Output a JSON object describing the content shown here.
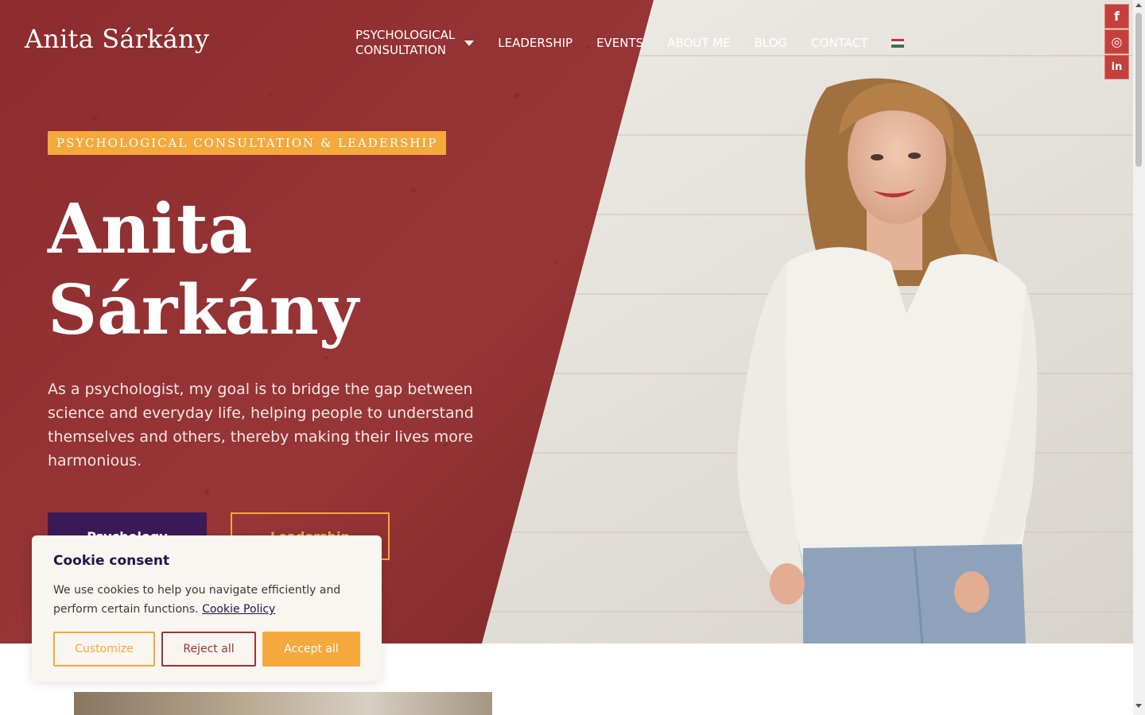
{
  "brand": {
    "logo_text": "Anita Sárkány"
  },
  "nav": {
    "items": [
      {
        "label_line1": "PSYCHOLOGICAL",
        "label_line2": "CONSULTATION",
        "has_dropdown": true
      },
      {
        "label": "LEADERSHIP"
      },
      {
        "label": "EVENTS"
      },
      {
        "label": "ABOUT ME"
      },
      {
        "label": "BLOG"
      },
      {
        "label": "CONTACT"
      }
    ],
    "language_flag": "hungary-flag-icon"
  },
  "social": [
    {
      "icon": "facebook-icon",
      "glyph": "f"
    },
    {
      "icon": "instagram-icon",
      "glyph": "◎"
    },
    {
      "icon": "linkedin-icon",
      "glyph": "in"
    }
  ],
  "hero": {
    "badge": "PSYCHOLOGICAL CONSULTATION & LEADERSHIP",
    "title_line1": "Anita",
    "title_line2": "Sárkány",
    "lead": "As a psychologist, my goal is to bridge the gap between science and everyday life, helping people to understand themselves and others, thereby making their lives more harmonious.",
    "buttons": {
      "primary": "Psychology",
      "secondary": "Leadership"
    }
  },
  "cookie": {
    "title": "Cookie consent",
    "text": "We use cookies to help you navigate efficiently and perform certain functions.",
    "link": "Cookie Policy",
    "buttons": {
      "customize": "Customize",
      "reject": "Reject all",
      "accept": "Accept all"
    }
  },
  "colors": {
    "accent": "#f5a83c",
    "hero_red": "#8f2f30",
    "primary_purple": "#3b1a58",
    "social_red": "#c4403d",
    "cookie_title": "#1e1848"
  }
}
